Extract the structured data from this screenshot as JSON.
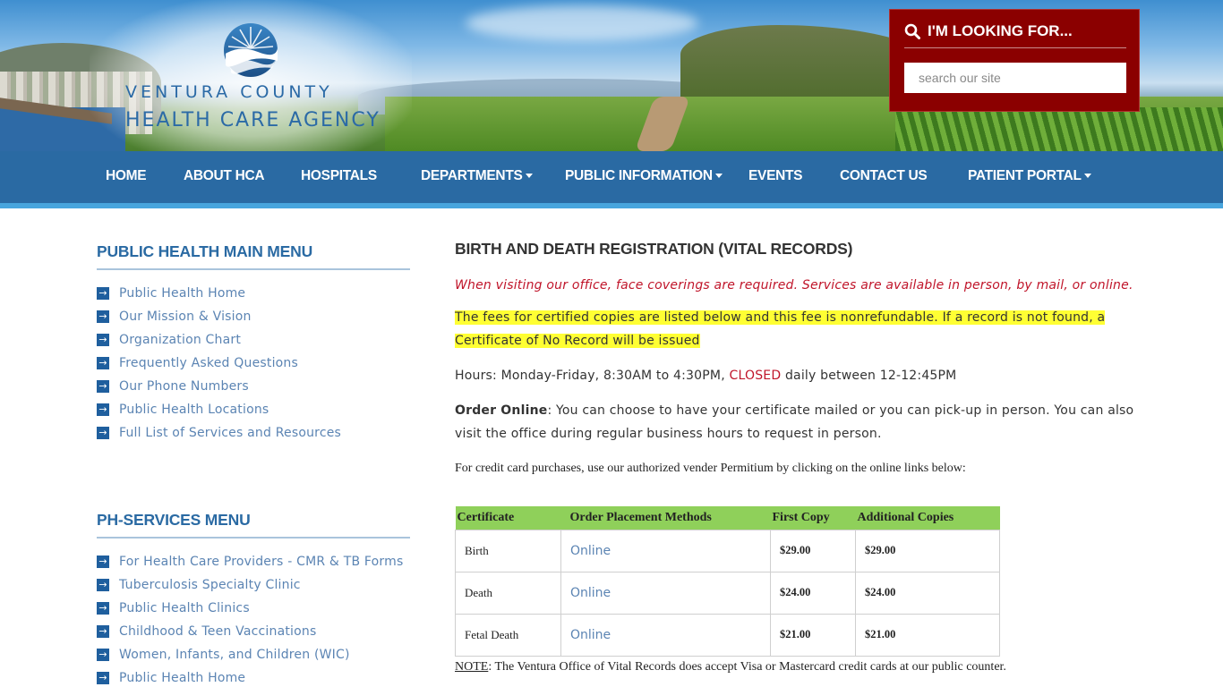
{
  "header": {
    "brand_line1": "VENTURA COUNTY",
    "brand_line2": "HEALTH CARE AGENCY",
    "logo_icon": "sun-wave-logo-icon"
  },
  "search": {
    "title": "I'M LOOKING FOR...",
    "placeholder": "search our site",
    "icon": "search-icon",
    "background": "#8b0000"
  },
  "nav": {
    "background": "#2a6aa3",
    "items": [
      {
        "label": "HOME",
        "dropdown": false
      },
      {
        "label": "ABOUT HCA",
        "dropdown": false
      },
      {
        "label": "HOSPITALS",
        "dropdown": false
      },
      {
        "label": "DEPARTMENTS",
        "dropdown": true
      },
      {
        "label": "PUBLIC INFORMATION",
        "dropdown": true
      },
      {
        "label": "EVENTS",
        "dropdown": false
      },
      {
        "label": "CONTACT US",
        "dropdown": false
      },
      {
        "label": "PATIENT PORTAL",
        "dropdown": true
      }
    ]
  },
  "sidebar": {
    "main_menu": {
      "heading": "PUBLIC HEALTH MAIN MENU",
      "items": [
        "Public Health Home",
        "Our Mission & Vision",
        "Organization Chart",
        "Frequently Asked Questions",
        "Our Phone Numbers",
        "Public Health Locations",
        "Full List of Services and Resources"
      ]
    },
    "services_menu": {
      "heading": "PH-SERVICES MENU",
      "items": [
        "For Health Care Providers - CMR & TB Forms",
        "Tuberculosis Specialty Clinic",
        "Public Health Clinics",
        "Childhood & Teen Vaccinations",
        "Women, Infants, and Children (WIC)",
        "Public Health Home"
      ]
    }
  },
  "main": {
    "title": "BIRTH AND DEATH REGISTRATION (VITAL RECORDS)",
    "notice": "When visiting our office, face coverings are required. Services are available in person, by mail, or online.",
    "fees_highlight": "The fees for certified copies are listed below and this fee is nonrefundable. If a record is not found, a Certificate of No Record will be issued",
    "hours_prefix": "Hours: Monday-Friday, 8:30AM to 4:30PM, ",
    "hours_closed": "CLOSED",
    "hours_suffix": " daily between 12-12:45PM",
    "order_label": "Order Online",
    "order_text": ": You can choose to have your certificate mailed or you can pick-up in person.  You can also visit the office during regular business hours to request in person.",
    "credit_text": "For credit card purchases, use our authorized vender Permitium by clicking on the online links below:",
    "table": {
      "headers": [
        "Certificate",
        "Order Placement Methods",
        "First Copy",
        "Additional Copies"
      ],
      "rows": [
        {
          "certificate": "Birth",
          "method": "Online",
          "first": "$29.00",
          "additional": "$29.00"
        },
        {
          "certificate": "Death",
          "method": "Online",
          "first": "$24.00",
          "additional": "$24.00"
        },
        {
          "certificate": "Fetal Death",
          "method": "Online",
          "first": "$21.00",
          "additional": "$21.00"
        }
      ],
      "header_color": "#8fd05a"
    },
    "note_label": "NOTE",
    "note_text": ": The Ventura Office of Vital Records does accept Visa or Mastercard credit cards at our public counter."
  }
}
